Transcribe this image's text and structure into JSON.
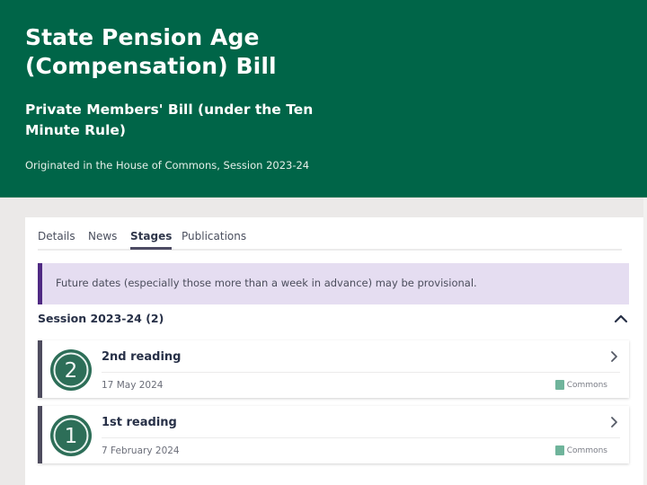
{
  "header": {
    "title": "State Pension Age (Compensation) Bill",
    "subtitle": "Private Members' Bill (under the Ten Minute Rule)",
    "origin": "Originated in the House of Commons, Session 2023-24"
  },
  "tabs": [
    {
      "label": "Details",
      "active": false
    },
    {
      "label": "News",
      "active": false
    },
    {
      "label": "Stages",
      "active": true
    },
    {
      "label": "Publications",
      "active": false
    }
  ],
  "notice": {
    "text": "Future dates (especially those more than a week in advance) may be provisional."
  },
  "session": {
    "title": "Session 2023-24 (2)",
    "expanded": true,
    "stages": [
      {
        "number": "2",
        "name": "2nd reading",
        "date": "17 May 2024",
        "house": "Commons",
        "house_icon": "commons-portcullis-icon"
      },
      {
        "number": "1",
        "name": "1st reading",
        "date": "7 February 2024",
        "house": "Commons",
        "house_icon": "commons-portcullis-icon"
      }
    ]
  },
  "colors": {
    "header_bg": "#006548",
    "stage_badge": "#2d6e58",
    "notice_bg": "#e5ddf1",
    "notice_border": "#4f2a83",
    "commons": "#6fb49b"
  }
}
